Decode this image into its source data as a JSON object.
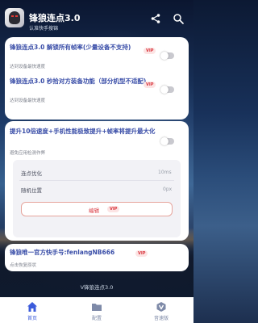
{
  "header": {
    "title": "锋狼连点3.0",
    "subtitle": "认准快手搜锦"
  },
  "card1": {
    "item1": {
      "title": "锋狼连点3.0 解锁所有帧率(少量设备不支持)",
      "subtitle": "达到设备最快速度",
      "badge": "VIP",
      "enabled": false
    },
    "item2": {
      "title": "锋狼连点3.0 秒拾对方装备功能（部分机型不适配)",
      "subtitle": "达到设备最快速度",
      "badge": "VIP",
      "enabled": false
    }
  },
  "card2": {
    "title": "提升10倍速度+手机性能极致提升+帧率将提升最大化",
    "subtitle": "避免应用检测作弊",
    "enabled": false,
    "rows": [
      {
        "label": "连点优化",
        "value": "10ms"
      },
      {
        "label": "随机位置",
        "value": "0px"
      }
    ],
    "edit_label": "编辑",
    "edit_badge": "VIP"
  },
  "card3": {
    "title": "锋狼唯一官方快手号:fenlangNB666",
    "subtitle": "点击恢复原状",
    "badge": "VIP"
  },
  "footer": {
    "version": "V锋狼连点3.0"
  },
  "nav": {
    "items": [
      {
        "label": "首页",
        "icon": "home-icon",
        "active": true
      },
      {
        "label": "配置",
        "icon": "folder-icon",
        "active": false
      },
      {
        "label": "音速版",
        "icon": "v-badge-icon",
        "active": false
      }
    ]
  },
  "colors": {
    "accent": "#3a4ea8",
    "vip_text": "#d9363e",
    "vip_bg": "#fce4e4",
    "nav_active": "#3b5bdb",
    "nav_inactive": "#7e8aa8"
  }
}
